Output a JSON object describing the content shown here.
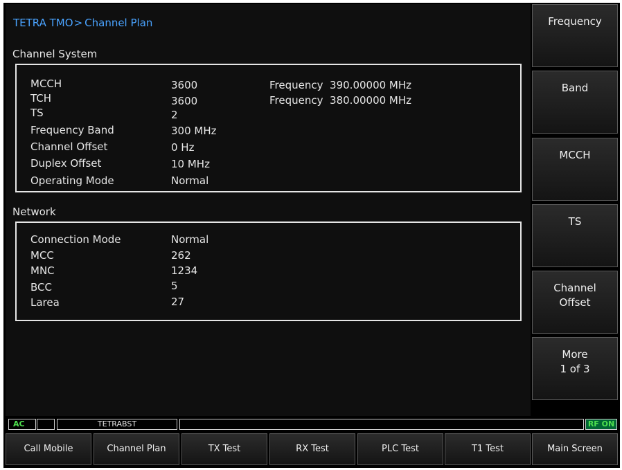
{
  "breadcrumb": {
    "root": "TETRA TMO",
    "separator": ">",
    "page": "Channel Plan"
  },
  "channel_system": {
    "title": "Channel System",
    "rows": [
      {
        "label": "MCCH",
        "value": "3600",
        "extra_label": "Frequency",
        "extra_value": "390.00000 MHz"
      },
      {
        "label": "TCH",
        "value": "3600",
        "extra_label": "Frequency",
        "extra_value": "380.00000 MHz"
      },
      {
        "label": "TS",
        "value": "2"
      },
      {
        "label": "Frequency Band",
        "value": "300 MHz"
      },
      {
        "label": "Channel Offset",
        "value": "0 Hz"
      },
      {
        "label": "Duplex Offset",
        "value": "10 MHz"
      },
      {
        "label": "Operating Mode",
        "value": "Normal"
      }
    ]
  },
  "network": {
    "title": "Network",
    "rows": [
      {
        "label": "Connection Mode",
        "value": "Normal"
      },
      {
        "label": "MCC",
        "value": "262"
      },
      {
        "label": "MNC",
        "value": "1234"
      },
      {
        "label": "BCC",
        "value": "5"
      },
      {
        "label": "Larea",
        "value": "27"
      }
    ]
  },
  "softkeys": [
    "Frequency",
    "Band",
    "MCCH",
    "TS",
    "Channel\nOffset",
    "More\n1 of 3"
  ],
  "status": {
    "ac": "AC",
    "system": "TETRABST",
    "rf": "RF ON"
  },
  "bottom_tabs": [
    "Call Mobile",
    "Channel Plan",
    "TX Test",
    "RX Test",
    "PLC Test",
    "T1 Test",
    "Main Screen"
  ],
  "colors": {
    "accent_title": "#4aa3ff",
    "status_green": "#4ee04e",
    "background": "#0f0f0f"
  }
}
